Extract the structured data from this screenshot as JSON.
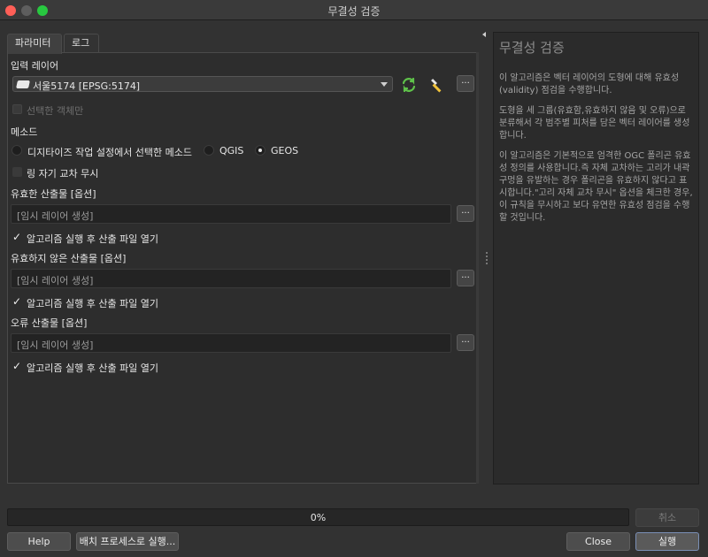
{
  "window": {
    "title": "무결성 검증"
  },
  "tabs": [
    {
      "label": "파라미터"
    },
    {
      "label": "로그"
    }
  ],
  "input_layer": {
    "label": "입력 레이어",
    "value": "서울5174 [EPSG:5174]"
  },
  "selected_only": {
    "label": "선택한 객체만"
  },
  "method": {
    "label": "메소드",
    "options": [
      {
        "label": "디지타이즈 작업 설정에서 선택한 메소드"
      },
      {
        "label": "QGIS"
      },
      {
        "label": "GEOS"
      }
    ]
  },
  "ignore_ring": {
    "label": "링 자기 교차 무시"
  },
  "outputs": [
    {
      "label": "유효한 산출물 [옵션]",
      "placeholder": "[임시 레이어 생성]",
      "open_label": "알고리즘 실행 후 산출 파일 열기"
    },
    {
      "label": "유효하지 않은 산출물 [옵션]",
      "placeholder": "[임시 레이어 생성]",
      "open_label": "알고리즘 실행 후 산출 파일 열기"
    },
    {
      "label": "오류 산출물 [옵션]",
      "placeholder": "[임시 레이어 생성]",
      "open_label": "알고리즘 실행 후 산출 파일 열기"
    }
  ],
  "dots_label": "...",
  "help": {
    "title": "무결성 검증",
    "paragraphs": [
      "이 알고리즘은 벡터 레이어의 도형에 대해 유효성(validity) 점검을 수행합니다.",
      "도형을 세 그룹(유효함,유효하지 않음 및 오류)으로 분류해서 각 범주별 피처를 담은 벡터 레이어를 생성합니다.",
      "이 알고리즘은 기본적으로 엄격한 OGC 폴리곤 유효성 정의를 사용합니다.즉 자체 교차하는 고리가 내곽 구멍을 유발하는 경우 폴리곤을 유효하지 않다고 표시합니다.\"고리 자체 교차 무시\" 옵션을 체크한 경우,이 규칙을 무시하고 보다 유연한 유효성 점검을 수행할 것입니다."
    ]
  },
  "progress": {
    "value": 0,
    "text": "0%"
  },
  "buttons": {
    "cancel": "취소",
    "help": "Help",
    "batch": "배치 프로세스로 실행...",
    "close": "Close",
    "run": "실행"
  },
  "colors": {
    "accent": "#7a8fb5",
    "close": "#ff5f57",
    "maximize": "#28c840"
  }
}
